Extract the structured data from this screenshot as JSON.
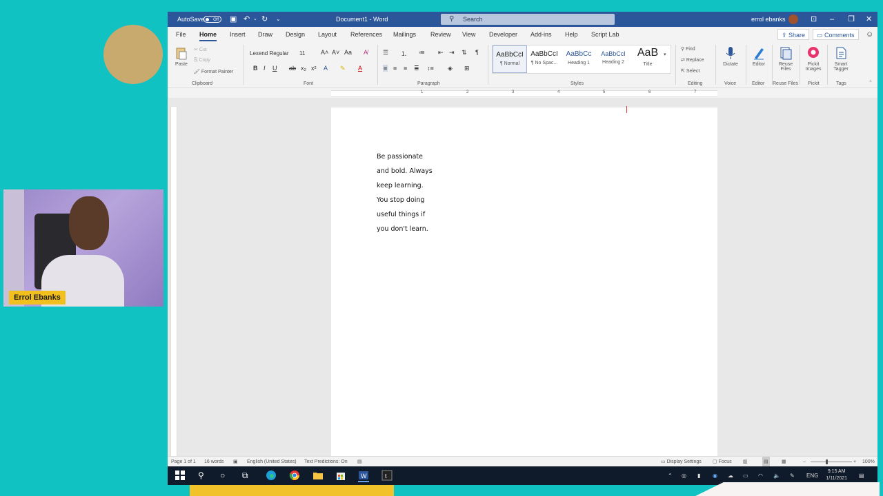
{
  "colors": {
    "background": "#10c2c2",
    "word_blue": "#2b579a",
    "accent_gold": "#c8a96e",
    "name_tag": "#f2c01e"
  },
  "webcam": {
    "name": "Errol Ebanks"
  },
  "titlebar": {
    "autosave_label": "AutoSave",
    "autosave_state": "Off",
    "doc_title": "Document1  -  Word",
    "search_placeholder": "Search",
    "user_name": "errol ebanks"
  },
  "menu": {
    "tabs": [
      "File",
      "Home",
      "Insert",
      "Draw",
      "Design",
      "Layout",
      "References",
      "Mailings",
      "Review",
      "View",
      "Developer",
      "Add-ins",
      "Help",
      "Script Lab"
    ],
    "active": "Home",
    "share": "Share",
    "comments": "Comments"
  },
  "ribbon": {
    "clipboard": {
      "paste": "Paste",
      "cut": "Cut",
      "copy": "Copy",
      "format_painter": "Format Painter",
      "label": "Clipboard"
    },
    "font": {
      "name": "Lexend Regular",
      "size": "11",
      "label": "Font"
    },
    "paragraph": {
      "label": "Paragraph"
    },
    "styles": {
      "items": [
        {
          "preview": "AaBbCcI",
          "name": "¶ Normal"
        },
        {
          "preview": "AaBbCcI",
          "name": "¶ No Spac..."
        },
        {
          "preview": "AaBbCc",
          "name": "Heading 1"
        },
        {
          "preview": "AaBbCcI",
          "name": "Heading 2"
        },
        {
          "preview": "AaB",
          "name": "Title"
        }
      ],
      "label": "Styles"
    },
    "editing": {
      "find": "Find",
      "replace": "Replace",
      "select": "Select",
      "label": "Editing"
    },
    "voice": {
      "dictate": "Dictate",
      "label": "Voice"
    },
    "editor": {
      "editor": "Editor",
      "label": "Editor"
    },
    "reuse": {
      "button": "Reuse Files",
      "label": "Reuse Files"
    },
    "pickit": {
      "button": "Pickit Images",
      "label": "Pickit"
    },
    "tags": {
      "button": "Smart Tagger",
      "label": "Tags"
    }
  },
  "ruler_numbers": [
    "1",
    "2",
    "3",
    "4",
    "5",
    "6",
    "7"
  ],
  "document": {
    "lines": [
      "Be passionate",
      "and bold. Always",
      "keep learning.",
      "You stop doing",
      "useful things if",
      "you don't learn."
    ]
  },
  "status": {
    "page": "Page 1 of 1",
    "words": "16 words",
    "language": "English (United States)",
    "predictions": "Text Predictions: On",
    "display_settings": "Display Settings",
    "focus": "Focus",
    "zoom": "100%"
  },
  "taskbar": {
    "lang": "ENG",
    "time": "9:15 AM",
    "date": "1/11/2021"
  }
}
